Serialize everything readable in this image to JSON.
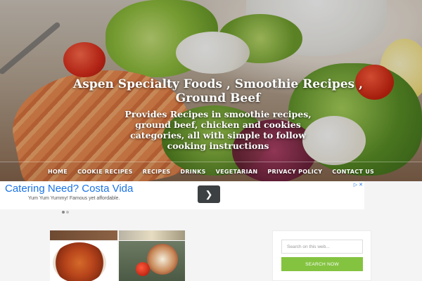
{
  "header": {
    "site_title": "Aspen Specialty Foods , Smoothie Recipes , Ground Beef",
    "site_description": "Provides Recipes in smoothie recipes, ground beef, chicken and cookies categories, all with simple to follow cooking instructions"
  },
  "nav": {
    "items": [
      {
        "label": "HOME"
      },
      {
        "label": "COOKIE RECIPES"
      },
      {
        "label": "RECIPES"
      },
      {
        "label": "DRINKS"
      },
      {
        "label": "VEGETARIAN"
      },
      {
        "label": "PRIVACY POLICY"
      },
      {
        "label": "CONTACT US"
      }
    ]
  },
  "ad": {
    "title": "Catering Need? Costa Vida",
    "subtitle": "Yum Yum Yummy! Famous yet affordable.",
    "next_icon": "chevron-right-icon",
    "ad_choices_icon": "ad-choices-icon",
    "close_icon": "close-icon",
    "active_dot": 0,
    "dot_count": 2
  },
  "sidebar": {
    "search_placeholder": "Search on this web...",
    "search_button": "SEARCH NOW"
  },
  "colors": {
    "accent_green": "#84c340",
    "ad_blue": "#1a73e8",
    "page_bg": "#f4f4f4"
  }
}
